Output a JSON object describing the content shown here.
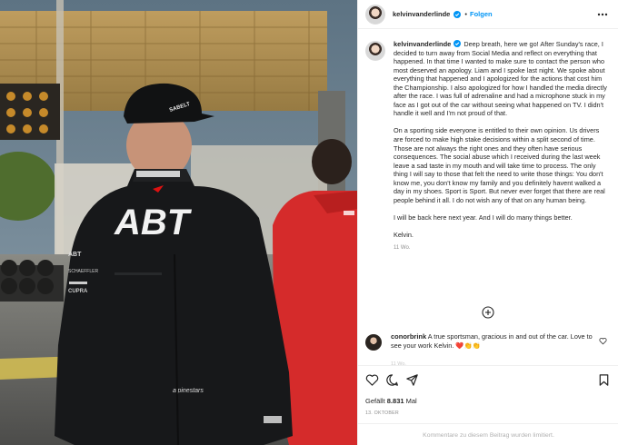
{
  "post": {
    "username": "kelvinvanderlinde",
    "follow_label": "Folgen",
    "separator": "•",
    "icons": {
      "verified": "verified-badge-icon",
      "more": "more-options-icon",
      "load_more": "plus-circle-icon",
      "like": "heart-icon",
      "comment": "comment-icon",
      "share": "share-icon",
      "save": "bookmark-icon"
    },
    "colors": {
      "link": "#0095f6",
      "text": "#262626",
      "muted": "#8e8e8e"
    }
  },
  "photo": {
    "suit_brand": "ABT",
    "cap_logo": "SABELT",
    "suit_sponsors": [
      "ABT",
      "SCHAEFFLER",
      "ALPINESTARS",
      "CUPRA"
    ]
  },
  "caption": {
    "username": "kelvinvanderlinde",
    "paragraphs": [
      "Deep breath, here we go! After Sunday's race, I decided to turn away from Social Media and reflect on everything that happened. In that time I wanted to make sure to contact the person who most deserved an apology. Liam and I spoke last night. We spoke about everything that happened and I apologized for the actions that cost him the Championship. I also apologized for how I handled the media directly after the race. I was full of adrenaline and had a microphone stuck in my face as I got out of the car without seeing what happened on TV. I didn't handle it well and I'm not proud of that.",
      "On a sporting side everyone is entitled to their own opinion. Us drivers are forced to make high stake decisions within a split second of time. Those are not always the right ones and they often have serious consequences. The social abuse which I received during the last week leave a sad taste in my mouth and will take time to process. The only thing I will say to those that felt the need to write those things: You don't know me, you don't know my family and you definitely havent walked a day in my shoes. Sport is Sport. But never ever forget that there are real people behind it all. I do not wish any of that on any human being.",
      "I will be back here next year. And I will do many things better.",
      "Kelvin."
    ],
    "time": "11 Wo."
  },
  "comment": {
    "username": "conorbrink",
    "text": "A true sportsman, gracious in and out of the car. Love to see your work Kelvin. ❤️👏👏",
    "meta": "11 Wo."
  },
  "footer": {
    "likes_prefix": "Gefällt ",
    "likes_count": "8.831",
    "likes_suffix": " Mal",
    "date": "13. OKTOBER",
    "limited_text": "Kommentare zu diesem Beitrag wurden limitiert."
  }
}
